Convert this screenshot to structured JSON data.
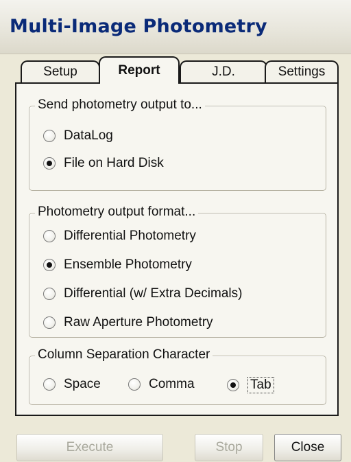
{
  "window": {
    "title": "Multi-Image Photometry"
  },
  "tabs": [
    {
      "label": "Setup",
      "active": false
    },
    {
      "label": "Report",
      "active": true
    },
    {
      "label": "J.D.",
      "active": false
    },
    {
      "label": "Settings",
      "active": false
    }
  ],
  "output_destination": {
    "legend": "Send photometry output to...",
    "options": [
      {
        "label": "DataLog",
        "checked": false
      },
      {
        "label": "File on Hard Disk",
        "checked": true
      }
    ]
  },
  "output_format": {
    "legend": "Photometry output format...",
    "options": [
      {
        "label": "Differential Photometry",
        "checked": false
      },
      {
        "label": "Ensemble Photometry",
        "checked": true
      },
      {
        "label": "Differential (w/ Extra Decimals)",
        "checked": false
      },
      {
        "label": "Raw Aperture Photometry",
        "checked": false
      }
    ]
  },
  "column_separator": {
    "legend": "Column Separation Character",
    "options": [
      {
        "label": "Space",
        "checked": false
      },
      {
        "label": "Comma",
        "checked": false
      },
      {
        "label": "Tab",
        "checked": true
      }
    ]
  },
  "buttons": {
    "execute": "Execute",
    "stop": "Stop",
    "close": "Close"
  }
}
